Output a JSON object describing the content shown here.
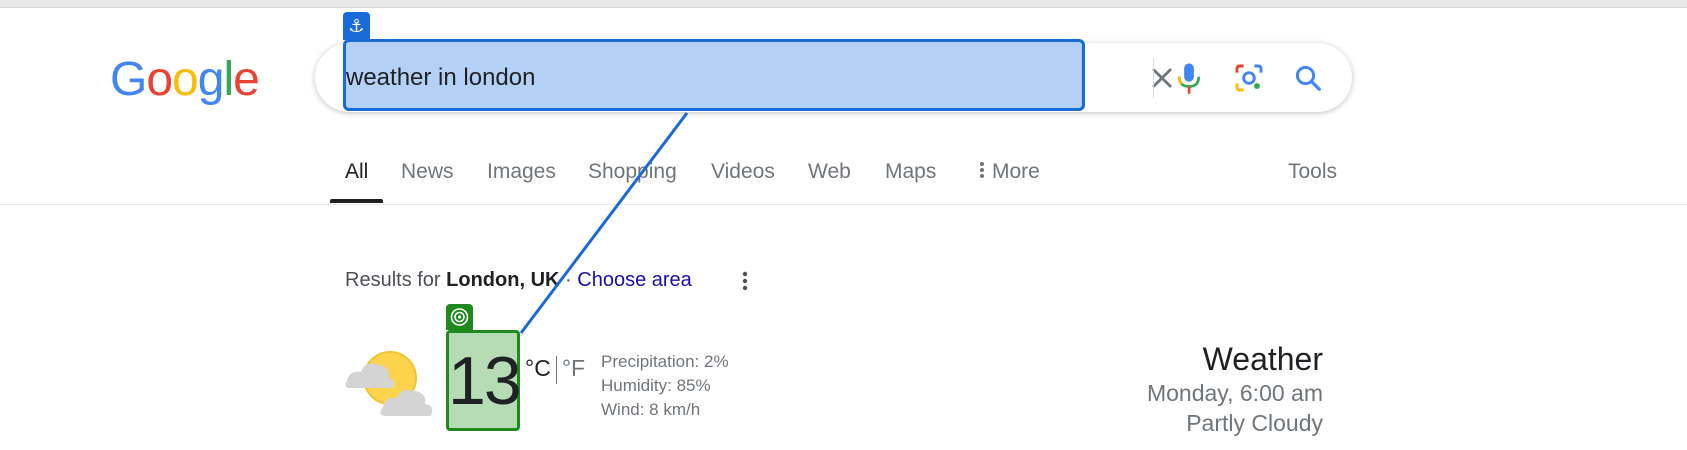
{
  "logo": {
    "letters": [
      "G",
      "o",
      "o",
      "g",
      "l",
      "e"
    ],
    "colors": [
      "#4285F4",
      "#EA4335",
      "#FBBC05",
      "#4285F4",
      "#34A853",
      "#EA4335"
    ]
  },
  "search": {
    "query": "weather in london",
    "highlight_color": "#1a6ad9"
  },
  "search_actions": {
    "clear": "close-icon",
    "voice": "mic-icon",
    "lens": "camera-icon",
    "submit": "search-icon"
  },
  "tabs": [
    {
      "label": "All",
      "active": true
    },
    {
      "label": "News"
    },
    {
      "label": "Images"
    },
    {
      "label": "Shopping"
    },
    {
      "label": "Videos"
    },
    {
      "label": "Web"
    },
    {
      "label": "Maps"
    },
    {
      "label": "More"
    }
  ],
  "tools_label": "Tools",
  "location": {
    "prefix": "Results for",
    "place": "London, UK",
    "separator": "·",
    "choose_label": "Choose area"
  },
  "weather": {
    "temperature": "13",
    "unit_c": "°C",
    "unit_f": "°F",
    "precipitation": "Precipitation: 2%",
    "humidity": "Humidity: 85%",
    "wind": "Wind: 8 km/h",
    "title": "Weather",
    "datetime": "Monday, 6:00 am",
    "condition": "Partly Cloudy"
  },
  "colors": {
    "target_green": "#1e8a1e",
    "link": "#1a0dab"
  }
}
